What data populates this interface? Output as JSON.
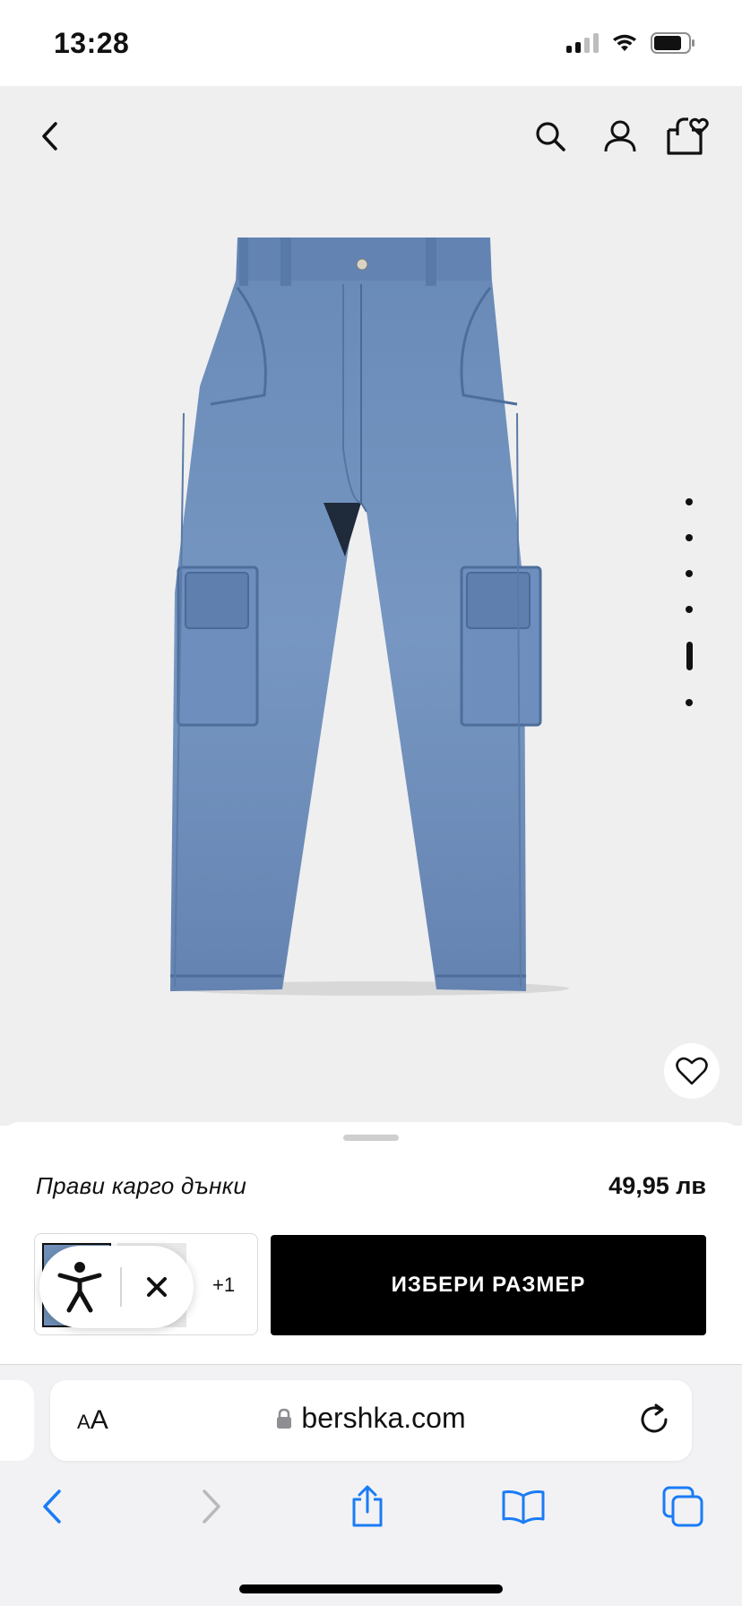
{
  "status_bar": {
    "time": "13:28"
  },
  "nav": {
    "back_icon": "chevron-left-icon",
    "search_icon": "search-icon",
    "account_icon": "user-icon",
    "bag_icon": "shopping-bag-heart-icon"
  },
  "gallery": {
    "image_count": 6,
    "active_index": 4
  },
  "product": {
    "name": "Прави карго дънки",
    "price": "49,95 лв",
    "more_colors": "+1",
    "choose_size_label": "ИЗБЕРИ РАЗМЕР"
  },
  "accessibility": {
    "icon": "accessibility-icon",
    "close_icon": "close-icon"
  },
  "browser": {
    "text_size_label_small": "A",
    "text_size_label_large": "A",
    "url": "bershka.com"
  },
  "colors": {
    "hero_bg": "#efefef",
    "denim": "#6f8fb8",
    "link_blue": "#1a7cf5",
    "button_black": "#000000"
  }
}
